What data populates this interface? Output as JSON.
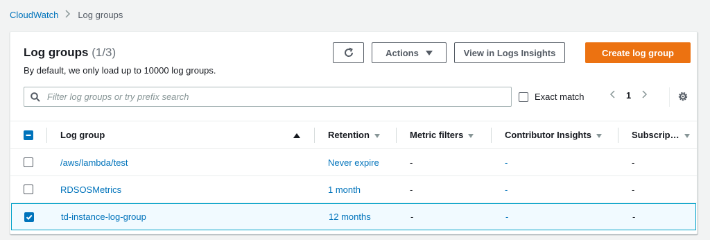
{
  "breadcrumb": {
    "root": "CloudWatch",
    "current": "Log groups"
  },
  "panel": {
    "title": "Log groups",
    "count": "(1/3)",
    "description": "By default, we only load up to 10000 log groups."
  },
  "buttons": {
    "actions": "Actions",
    "insights": "View in Logs Insights",
    "create": "Create log group"
  },
  "search": {
    "placeholder": "Filter log groups or try prefix search",
    "value": ""
  },
  "exact_match": {
    "label": "Exact match",
    "checked": false
  },
  "pagination": {
    "page": "1"
  },
  "table": {
    "columns": {
      "log_group": "Log group",
      "retention": "Retention",
      "metric_filters": "Metric filters",
      "contributor_insights": "Contributor Insights",
      "subscriptions": "Subscrip…"
    },
    "rows": [
      {
        "name": "/aws/lambda/test",
        "retention": "Never expire",
        "metric_filters": "-",
        "contributor_insights": "-",
        "subscriptions": "-",
        "selected": false
      },
      {
        "name": "RDSOSMetrics",
        "retention": "1 month",
        "metric_filters": "-",
        "contributor_insights": "-",
        "subscriptions": "-",
        "selected": false
      },
      {
        "name": "td-instance-log-group",
        "retention": "12 months",
        "metric_filters": "-",
        "contributor_insights": "-",
        "subscriptions": "-",
        "selected": true
      }
    ]
  },
  "colors": {
    "link": "#0073bb",
    "primary": "#ec7211",
    "selected_bg": "#f1faff",
    "selected_border": "#00a1c9"
  }
}
